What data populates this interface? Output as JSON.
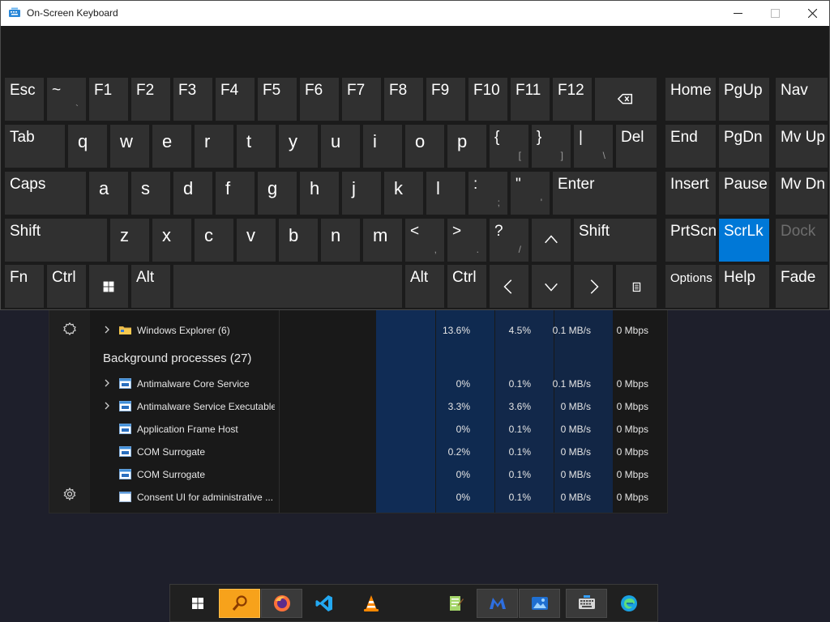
{
  "window": {
    "title": "On-Screen Keyboard",
    "controls": [
      "minimize",
      "maximize",
      "close"
    ]
  },
  "keyboard": {
    "rows": [
      [
        {
          "label": "Esc"
        },
        {
          "label": "~",
          "sub": "`"
        },
        {
          "label": "F1"
        },
        {
          "label": "F2"
        },
        {
          "label": "F3"
        },
        {
          "label": "F4"
        },
        {
          "label": "F5"
        },
        {
          "label": "F6"
        },
        {
          "label": "F7"
        },
        {
          "label": "F8"
        },
        {
          "label": "F9"
        },
        {
          "label": "F10"
        },
        {
          "label": "F11"
        },
        {
          "label": "F12"
        },
        {
          "label": "",
          "icon": "backspace-icon"
        }
      ],
      [
        {
          "label": "Tab"
        },
        {
          "label": "q"
        },
        {
          "label": "w"
        },
        {
          "label": "e"
        },
        {
          "label": "r"
        },
        {
          "label": "t"
        },
        {
          "label": "y"
        },
        {
          "label": "u"
        },
        {
          "label": "i"
        },
        {
          "label": "o"
        },
        {
          "label": "p"
        },
        {
          "label": "{",
          "sub": "["
        },
        {
          "label": "}",
          "sub": "]"
        },
        {
          "label": "|",
          "sub": "\\"
        },
        {
          "label": "Del"
        }
      ],
      [
        {
          "label": "Caps"
        },
        {
          "label": "a"
        },
        {
          "label": "s"
        },
        {
          "label": "d"
        },
        {
          "label": "f"
        },
        {
          "label": "g"
        },
        {
          "label": "h"
        },
        {
          "label": "j"
        },
        {
          "label": "k"
        },
        {
          "label": "l"
        },
        {
          "label": ":",
          "sub": ";"
        },
        {
          "label": "\"",
          "sub": "'"
        },
        {
          "label": "Enter"
        }
      ],
      [
        {
          "label": "Shift"
        },
        {
          "label": "z"
        },
        {
          "label": "x"
        },
        {
          "label": "c"
        },
        {
          "label": "v"
        },
        {
          "label": "b"
        },
        {
          "label": "n"
        },
        {
          "label": "m"
        },
        {
          "label": "<",
          "sub": ","
        },
        {
          "label": ">",
          "sub": "."
        },
        {
          "label": "?",
          "sub": "/"
        },
        {
          "label": "",
          "icon": "arrow-up-icon"
        },
        {
          "label": "Shift"
        }
      ],
      [
        {
          "label": "Fn"
        },
        {
          "label": "Ctrl"
        },
        {
          "label": "",
          "icon": "windows-logo-icon"
        },
        {
          "label": "Alt"
        },
        {
          "label": ""
        },
        {
          "label": "Alt"
        },
        {
          "label": "Ctrl"
        },
        {
          "label": "",
          "icon": "arrow-left-icon"
        },
        {
          "label": "",
          "icon": "arrow-down-icon"
        },
        {
          "label": "",
          "icon": "arrow-right-icon"
        },
        {
          "label": "",
          "icon": "context-menu-icon"
        }
      ]
    ],
    "nav_keys": [
      [
        {
          "label": "Home"
        },
        {
          "label": "PgUp"
        },
        {
          "label": "Nav"
        }
      ],
      [
        {
          "label": "End"
        },
        {
          "label": "PgDn"
        },
        {
          "label": "Mv Up"
        }
      ],
      [
        {
          "label": "Insert"
        },
        {
          "label": "Pause"
        },
        {
          "label": "Mv Dn"
        }
      ],
      [
        {
          "label": "PrtScn"
        },
        {
          "label": "ScrLk",
          "state": "active"
        },
        {
          "label": "Dock",
          "state": "disabled"
        }
      ],
      [
        {
          "label": "Options"
        },
        {
          "label": "Help"
        },
        {
          "label": "Fade"
        }
      ]
    ],
    "active_color": "#0078d7"
  },
  "task_manager": {
    "apps_rows": [
      {
        "name": "Windows Explorer (6)",
        "cpu": "13.6%",
        "memory": "4.5%",
        "disk": "0.1 MB/s",
        "network": "0 Mbps",
        "expandable": true,
        "icon": "folder-icon"
      }
    ],
    "group_label": "Background processes (27)",
    "background_rows": [
      {
        "name": "Antimalware Core Service",
        "cpu": "0%",
        "memory": "0.1%",
        "disk": "0.1 MB/s",
        "network": "0 Mbps",
        "expandable": true,
        "icon": "app-window-icon"
      },
      {
        "name": "Antimalware Service Executable",
        "cpu": "3.3%",
        "memory": "3.6%",
        "disk": "0 MB/s",
        "network": "0 Mbps",
        "expandable": true,
        "icon": "app-window-icon",
        "highlight": true
      },
      {
        "name": "Application Frame Host",
        "cpu": "0%",
        "memory": "0.1%",
        "disk": "0 MB/s",
        "network": "0 Mbps",
        "expandable": false,
        "icon": "app-window-icon"
      },
      {
        "name": "COM Surrogate",
        "cpu": "0.2%",
        "memory": "0.1%",
        "disk": "0 MB/s",
        "network": "0 Mbps",
        "expandable": false,
        "icon": "app-window-icon"
      },
      {
        "name": "COM Surrogate",
        "cpu": "0%",
        "memory": "0.1%",
        "disk": "0 MB/s",
        "network": "0 Mbps",
        "expandable": false,
        "icon": "app-window-icon"
      },
      {
        "name": "Consent UI for administrative ...",
        "cpu": "0%",
        "memory": "0.1%",
        "disk": "0 MB/s",
        "network": "0 Mbps",
        "expandable": false,
        "icon": "blank-window-icon"
      }
    ],
    "rail_icons": [
      "services-icon",
      "settings-gear-icon"
    ]
  },
  "taskbar": {
    "items": [
      {
        "name": "start-button",
        "icon": "windows-logo-icon"
      },
      {
        "name": "search-app",
        "icon": "magnifier-icon"
      },
      {
        "name": "firefox",
        "icon": "firefox-icon"
      },
      {
        "name": "vscode",
        "icon": "vscode-icon"
      },
      {
        "name": "vlc",
        "icon": "vlc-cone-icon"
      },
      {
        "name": "notepad-plus-plus",
        "icon": "notepad-icon"
      },
      {
        "name": "malwarebytes",
        "icon": "malwarebytes-icon"
      },
      {
        "name": "photos",
        "icon": "photos-icon"
      },
      {
        "name": "on-screen-keyboard",
        "icon": "keyboard-icon"
      },
      {
        "name": "edge",
        "icon": "edge-icon"
      }
    ]
  }
}
